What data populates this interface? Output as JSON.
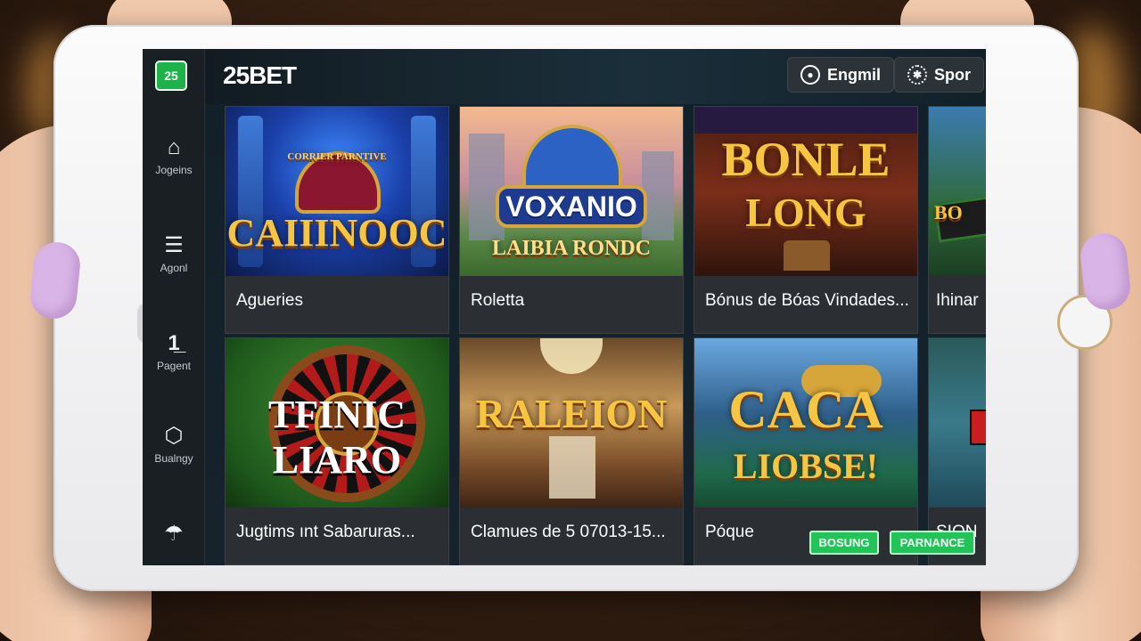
{
  "app": {
    "brand": "25BET",
    "logo_text": "25"
  },
  "topbar": {
    "language_label": "Engmil",
    "sport_label": "Spor"
  },
  "sidebar": {
    "items": [
      {
        "label": "Jogeins",
        "icon": "home-icon"
      },
      {
        "label": "Agonl",
        "icon": "menu-icon"
      },
      {
        "label": "Pagent",
        "icon": "user-icon"
      },
      {
        "label": "Bualngy",
        "icon": "shield-icon"
      },
      {
        "label": "",
        "icon": "wifi-icon"
      }
    ]
  },
  "games": [
    {
      "caption": "Agueries",
      "art_title": "CAIIINOOC",
      "art_subtitle": "CORRIER PARNTIVE"
    },
    {
      "caption": "Roletta",
      "art_title": "VOXANIO",
      "art_subtitle": "LAIBIA RONDC"
    },
    {
      "caption": "Bónus de Bóas Vindades...",
      "art_title": "BONLE",
      "art_subtitle": "LONG"
    },
    {
      "caption": "Ihinar",
      "art_title": "BO",
      "art_subtitle": ""
    },
    {
      "caption": "Jugtims ınt Sabaruras...",
      "art_title": "TFINIC LIARO",
      "art_subtitle": ""
    },
    {
      "caption": "Clamues de 5 07013-15...",
      "art_title": "RALEION",
      "art_subtitle": ""
    },
    {
      "caption": "Póque",
      "art_title": "CACA",
      "art_subtitle": "LIOBSE!"
    },
    {
      "caption": "SIQN",
      "art_title": "",
      "art_subtitle": ""
    }
  ],
  "actions": {
    "bonus_label": "BOSUNG",
    "parnance_label": "PARNANCE"
  },
  "colors": {
    "accent_green": "#22c457",
    "sidebar_bg": "#1a1f24",
    "tile_bg": "#2b2f33",
    "gold": "#f6c542"
  }
}
